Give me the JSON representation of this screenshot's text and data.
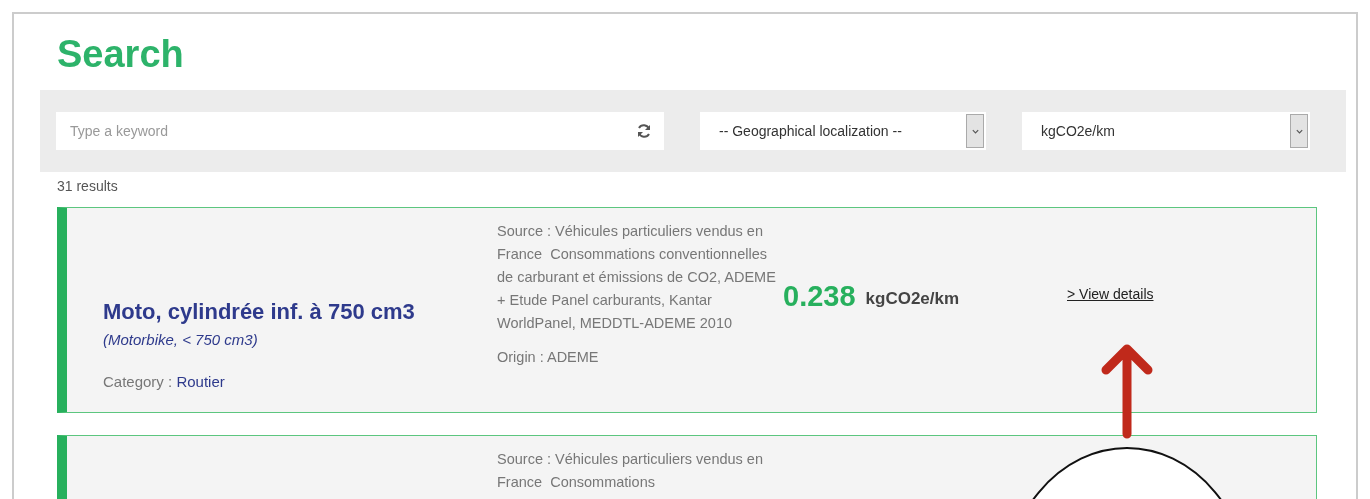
{
  "title": "Search",
  "filters": {
    "keyword": {
      "placeholder": "Type a keyword"
    },
    "location": {
      "value": "-- Geographical localization --"
    },
    "unit": {
      "value": "kgCO2e/km"
    }
  },
  "result_count": "31 results",
  "results": [
    {
      "name": "Moto, cylindrée inf. à 750 cm3",
      "subtitle": "(Motorbike, < 750 cm3)",
      "category_label": "Category :",
      "category": "Routier",
      "source": "Source : Véhicules particuliers vendus en France  Consommations conventionnelles de carburant et émissions de CO2, ADEME + Etude Panel carburants, Kantar WorldPanel, MEDDTL-ADEME 2010",
      "origin": "Origin : ADEME",
      "value": "0.238",
      "unit": "kgCO2e/km",
      "link": "> View details"
    },
    {
      "source": "Source : Véhicules particuliers vendus en France  Consommations"
    }
  ]
}
